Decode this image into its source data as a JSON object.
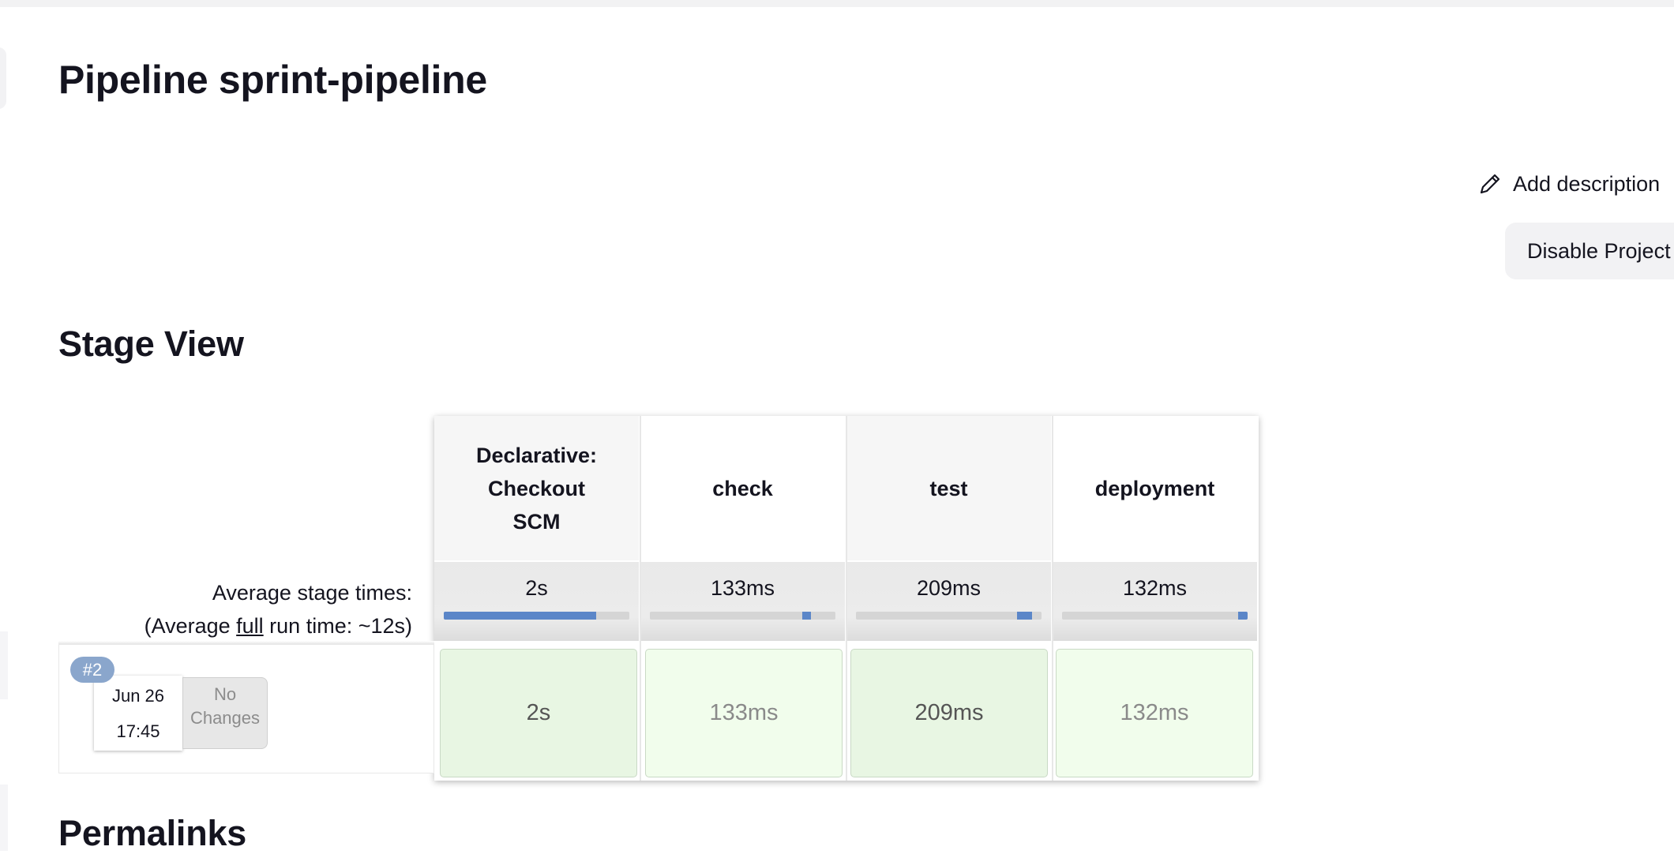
{
  "page": {
    "title": "Pipeline sprint-pipeline",
    "add_description": "Add description",
    "disable_project": "Disable Project"
  },
  "stage_view": {
    "title": "Stage View",
    "avg_label_line1": "Average stage times:",
    "avg_label_prefix": "(Average ",
    "avg_label_link": "full",
    "avg_label_suffix": " run time: ~12s)",
    "stages": [
      {
        "name": "Declarative: Checkout SCM",
        "avg_time": "2s",
        "avg_progress": 0.82
      },
      {
        "name": "check",
        "avg_time": "133ms",
        "avg_progress": 0.05
      },
      {
        "name": "test",
        "avg_time": "209ms",
        "avg_progress": 0.08
      },
      {
        "name": "deployment",
        "avg_time": "132ms",
        "avg_progress": 0.05
      }
    ],
    "runs": [
      {
        "number": "#2",
        "date": "Jun 26",
        "time": "17:45",
        "changes": "No Changes",
        "stage_times": [
          "2s",
          "133ms",
          "209ms",
          "132ms"
        ]
      }
    ]
  },
  "permalinks": {
    "title": "Permalinks"
  },
  "colors": {
    "stage_success_dark": "#e8f6e3",
    "stage_success_light": "#f1fdec",
    "progress_fill": "#5b86c8",
    "run_badge": "#8aa6cc"
  },
  "icons": {
    "add_description": "pencil-icon"
  }
}
